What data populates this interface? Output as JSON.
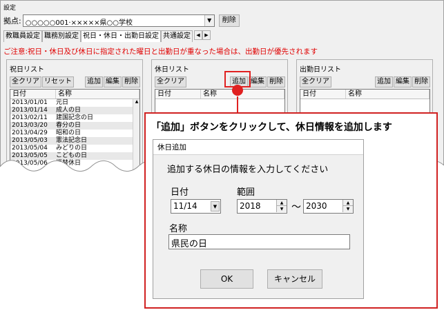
{
  "window": {
    "title": "設定"
  },
  "toolbar": {
    "base_label": "拠点:",
    "base_value": "○○○○○001·×××××県○○学校",
    "delete_label": "削除"
  },
  "tabs": [
    {
      "label": "教職員設定",
      "active": false
    },
    {
      "label": "職務別設定",
      "active": false
    },
    {
      "label": "祝日・休日・出勤日設定",
      "active": true
    },
    {
      "label": "共通設定",
      "active": false
    }
  ],
  "notice": "ご注意:祝日・休日及び休日に指定された曜日と出勤日が重なった場合は、出勤日が優先されます",
  "panels": {
    "holiday": {
      "title": "祝日リスト",
      "clear_label": "全クリア",
      "reset_label": "リセット",
      "add_label": "追加",
      "edit_label": "編集",
      "delete_label": "削除",
      "col_date": "日付",
      "col_name": "名称",
      "rows": [
        {
          "date": "2013/01/01",
          "name": "元日"
        },
        {
          "date": "2013/01/14",
          "name": "成人の日"
        },
        {
          "date": "2013/02/11",
          "name": "建国記念の日"
        },
        {
          "date": "2013/03/20",
          "name": "春分の日"
        },
        {
          "date": "2013/04/29",
          "name": "昭和の日"
        },
        {
          "date": "2013/05/03",
          "name": "憲法記念日"
        },
        {
          "date": "2013/05/04",
          "name": "みどりの日"
        },
        {
          "date": "2013/05/05",
          "name": "こどもの日"
        },
        {
          "date": "2013/05/06",
          "name": "振替休日"
        }
      ]
    },
    "dayoff": {
      "title": "休日リスト",
      "clear_label": "全クリア",
      "add_label": "追加",
      "edit_label": "編集",
      "delete_label": "削除",
      "col_date": "日付",
      "col_name": "名称"
    },
    "workday": {
      "title": "出勤日リスト",
      "clear_label": "全クリア",
      "add_label": "追加",
      "edit_label": "編集",
      "delete_label": "削除",
      "col_date": "日付",
      "col_name": "名称"
    }
  },
  "callout": {
    "heading": "「追加」ボタンをクリックして、休日情報を追加します",
    "accent": "#d02020"
  },
  "dialog": {
    "title": "休日追加",
    "prompt": "追加する休日の情報を入力してください",
    "date_label": "日付",
    "date_value": "11/14",
    "range_label": "範囲",
    "range_from": "2018",
    "range_sep": "〜",
    "range_to": "2030",
    "name_label": "名称",
    "name_value": "県民の日",
    "ok_label": "OK",
    "cancel_label": "キャンセル"
  }
}
